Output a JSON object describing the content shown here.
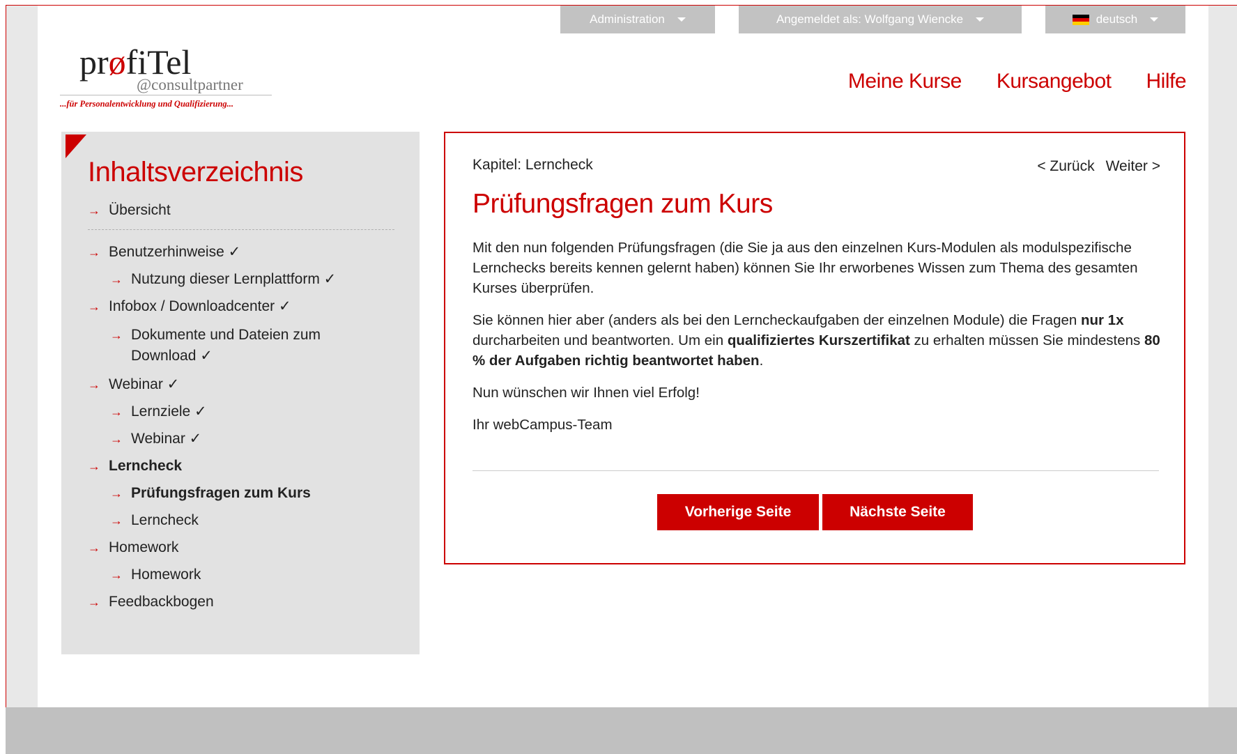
{
  "topbar": {
    "admin_label": "Administration",
    "user_label": "Angemeldet als: Wolfgang Wiencke",
    "language_label": "deutsch"
  },
  "logo": {
    "name_pre": "pr",
    "name_o": "ø",
    "name_post": "fiTel",
    "sub": "@consultpartner",
    "tagline": "...für Personalentwicklung und Qualifizierung..."
  },
  "mainnav": {
    "items": [
      {
        "label": "Meine Kurse"
      },
      {
        "label": "Kursangebot"
      },
      {
        "label": "Hilfe"
      }
    ]
  },
  "sidebar": {
    "title": "Inhaltsverzeichnis",
    "items": [
      {
        "label": "Übersicht"
      },
      {
        "label": "Benutzerhinweise ✓"
      },
      {
        "label": "Nutzung dieser Lernplattform ✓"
      },
      {
        "label": "Infobox / Downloadcenter ✓"
      },
      {
        "label": "Dokumente und Dateien zum Download ✓"
      },
      {
        "label": "Webinar ✓"
      },
      {
        "label": "Lernziele ✓"
      },
      {
        "label": "Webinar ✓"
      },
      {
        "label": "Lerncheck"
      },
      {
        "label": "Prüfungsfragen zum Kurs"
      },
      {
        "label": "Lerncheck"
      },
      {
        "label": "Homework"
      },
      {
        "label": "Homework"
      },
      {
        "label": "Feedbackbogen"
      }
    ]
  },
  "content": {
    "chapter": "Kapitel: Lerncheck",
    "back_label": "< Zurück",
    "next_label": "Weiter >",
    "title": "Prüfungsfragen zum Kurs",
    "p1": "Mit den nun folgenden Prüfungsfragen (die Sie ja aus den einzelnen Kurs-Modulen als modulspezifische Lernchecks bereits kennen gelernt haben) können Sie Ihr erworbenes Wissen zum Thema des gesamten Kurses überprüfen.",
    "p2_a": "Sie können hier aber (anders als bei den Lerncheckaufgaben der einzelnen Module) die Fragen ",
    "p2_b": "nur 1x",
    "p2_c": " durcharbeiten und beantworten. Um ein ",
    "p2_d": "qualifiziertes Kurszertifikat",
    "p2_e": " zu erhalten müssen Sie mindestens ",
    "p2_f": "80 % der Aufgaben richtig beantwortet haben",
    "p2_g": ".",
    "p3": "Nun wünschen wir Ihnen viel Erfolg!",
    "p4": "Ihr webCampus-Team",
    "prev_button": "Vorherige Seite",
    "next_button": "Nächste Seite"
  },
  "colors": {
    "accent": "#cc0000",
    "topbar": "#c2c2c2",
    "sidebar_bg": "#e2e2e2",
    "footer": "#c0c0c0"
  }
}
